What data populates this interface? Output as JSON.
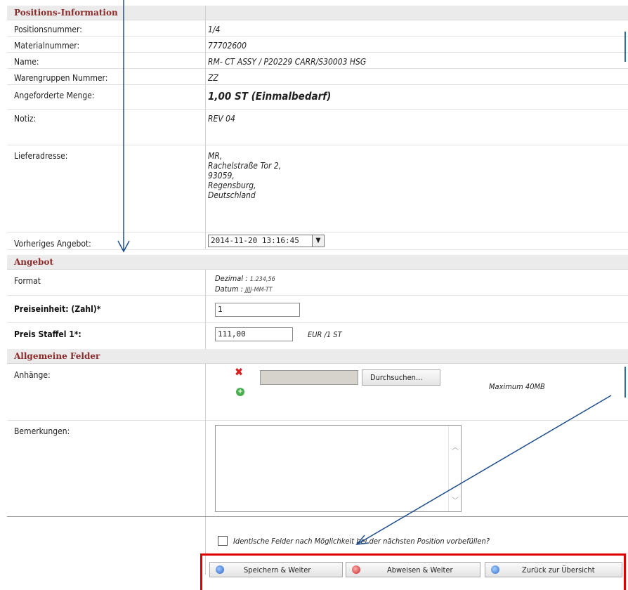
{
  "sections": {
    "positions": "Positions-Information",
    "angebot": "Angebot",
    "allgemein": "Allgemeine Felder"
  },
  "fields": {
    "positionsnummer": {
      "label": "Positionsnummer:",
      "value": "1/4"
    },
    "materialnummer": {
      "label": "Materialnummer:",
      "value": "77702600"
    },
    "name": {
      "label": "Name:",
      "value": "RM- CT ASSY / P20229 CARR/S30003 HSG"
    },
    "warengruppe": {
      "label": "Warengruppen Nummer:",
      "value": "ZZ"
    },
    "menge": {
      "label": "Angeforderte Menge:",
      "value": "1,00 ST (Einmalbedarf)"
    },
    "notiz": {
      "label": "Notiz:",
      "value": "REV 04"
    },
    "lieferadresse": {
      "label": "Lieferadresse:",
      "lines": [
        "MR,",
        "Rachelstraße Tor 2,",
        "93059,",
        "Regensburg,",
        "Deutschland"
      ]
    },
    "vorheriges": {
      "label": "Vorheriges Angebot:",
      "value": "2014-11-20 13:16:45"
    },
    "format": {
      "label": "Format",
      "dezimal_label": "Dezimal :",
      "dezimal_value": "1.234,56",
      "datum_label": "Datum :",
      "datum_value": "JJJJ-MM-TT"
    },
    "preiseinheit": {
      "label": "Preiseinheit: (Zahl)*",
      "value": "1"
    },
    "preis": {
      "label": "Preis Staffel 1*:",
      "value": "111,00",
      "unit": "EUR /1 ST"
    },
    "anhaenge": {
      "label": "Anhänge:",
      "browse": "Durchsuchen...",
      "max": "Maximum 40MB"
    },
    "bemerkungen": {
      "label": "Bemerkungen:"
    }
  },
  "prefill_label": "Identische Felder nach Möglichkeit bei der nächsten Position vorbefüllen?",
  "buttons": {
    "save": "Speichern & Weiter",
    "reject": "Abweisen & Weiter",
    "back": "Zurück zur Übersicht"
  },
  "colors": {
    "section_text": "#8b2b2b",
    "highlight": "#e00000",
    "arrow": "#1f4e8c"
  }
}
